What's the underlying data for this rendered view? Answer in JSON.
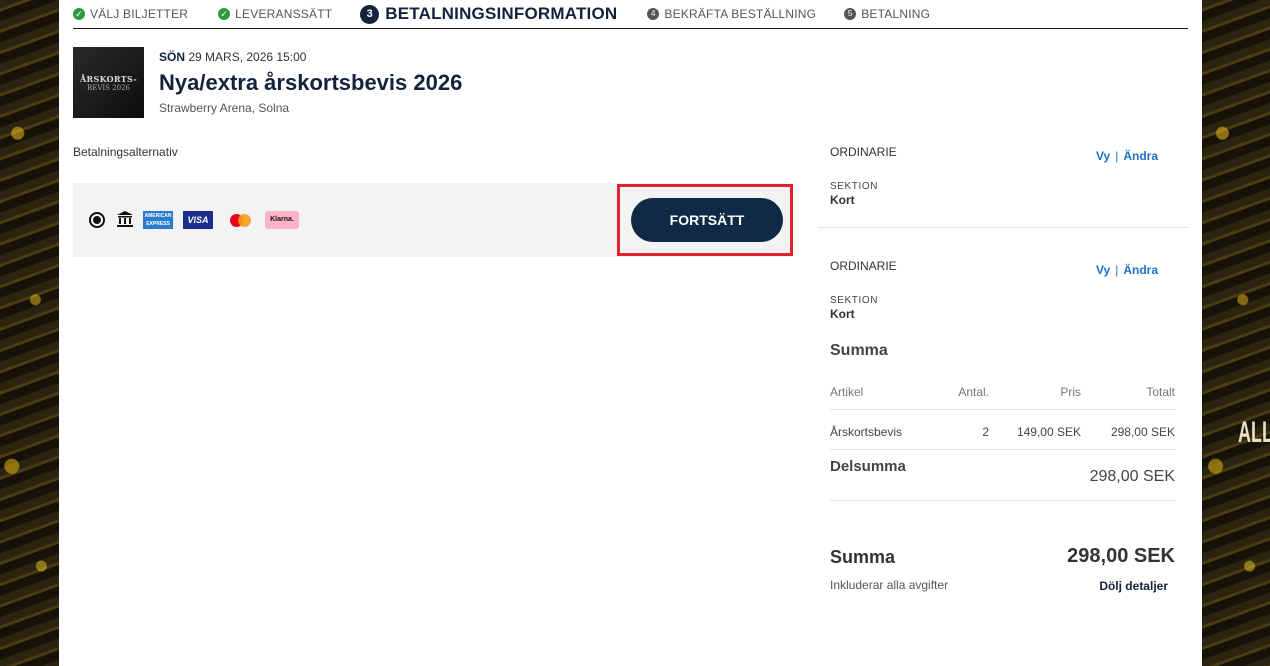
{
  "steps": {
    "step1": "VÄLJ BILJETTER",
    "step2": "LEVERANSSÄTT",
    "step3_num": "3",
    "step3": "BETALNINGSINFORMATION",
    "step4_num": "4",
    "step4": "BEKRÄFTA BESTÄLLNING",
    "step5_num": "5",
    "step5": "BETALNING"
  },
  "event": {
    "thumb_line1": "ÅRSKORTS-",
    "thumb_line2": "BEVIS 2026",
    "day": "SÖN",
    "datetime": "29 MARS, 2026 15:00",
    "title": "Nya/extra årskortsbevis 2026",
    "venue": "Strawberry Arena, Solna"
  },
  "payment": {
    "label": "Betalningsalternativ",
    "amex_text": "AMERICAN EXPRESS",
    "visa_text": "VISA",
    "klarna_text": "Klarna.",
    "continue_label": "FORTSÄTT"
  },
  "tickets": [
    {
      "type": "ORDINARIE",
      "view": "Vy",
      "sep": "|",
      "change": "Ändra",
      "section_label": "SEKTION",
      "section_value": "Kort"
    },
    {
      "type": "ORDINARIE",
      "view": "Vy",
      "sep": "|",
      "change": "Ändra",
      "section_label": "SEKTION",
      "section_value": "Kort"
    }
  ],
  "summary": {
    "title": "Summa",
    "headers": {
      "article": "Artikel",
      "qty": "Antal.",
      "price": "Pris",
      "total": "Totalt"
    },
    "row": {
      "article": "Årskortsbevis",
      "qty": "2",
      "price": "149,00 SEK",
      "total": "298,00 SEK"
    },
    "subtotal_label": "Delsumma",
    "subtotal_value": "298,00 SEK",
    "total_label": "Summa",
    "total_value": "298,00 SEK",
    "note": "Inkluderar alla avgifter",
    "hide_details": "Dölj detaljer"
  },
  "background": {
    "right_text": "ALL"
  },
  "colors": {
    "accent": "#1e72c8",
    "navy": "#0f2a44",
    "check_green": "#2e9c3e",
    "highlight": "#e3232c"
  }
}
